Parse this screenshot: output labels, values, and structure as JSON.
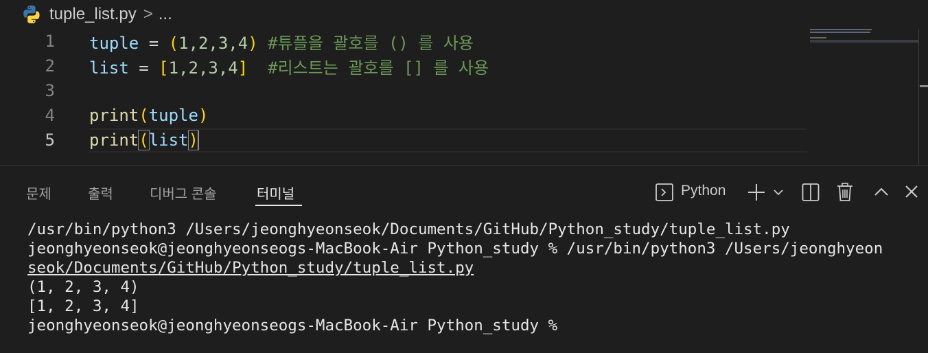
{
  "breadcrumb": {
    "file": "tuple_list.py",
    "separator": ">",
    "more": "..."
  },
  "editor": {
    "active_line": 5,
    "lines": [
      {
        "number": "1"
      },
      {
        "number": "2"
      },
      {
        "number": "3"
      },
      {
        "number": "4"
      },
      {
        "number": "5"
      }
    ],
    "tokens": {
      "l1_var": "tuple",
      "l1_eq": " = ",
      "l1_open": "(",
      "l1_nums": "1,2,3,4",
      "l1_close": ")",
      "l1_comment": " #튜플을 괄호를 () 를 사용",
      "l2_var": "list",
      "l2_eq": " = ",
      "l2_open": "[",
      "l2_nums": "1,2,3,4",
      "l2_close": "]",
      "l2_comment": "  #리스트는 괄호를 [] 를 사용",
      "l4_fn": "print",
      "l4_open": "(",
      "l4_arg": "tuple",
      "l4_close": ")",
      "l5_fn": "print",
      "l5_open": "(",
      "l5_arg": "list",
      "l5_close": ")"
    }
  },
  "panel": {
    "tabs": [
      {
        "label": "문제",
        "active": false
      },
      {
        "label": "출력",
        "active": false
      },
      {
        "label": "디버그 콘솔",
        "active": false
      },
      {
        "label": "터미널",
        "active": true
      }
    ],
    "terminal_name": "Python",
    "icons": [
      "terminal-icon",
      "add-icon",
      "chevron-down-icon",
      "split-icon",
      "trash-icon",
      "chevron-up-icon",
      "close-icon"
    ]
  },
  "terminal": {
    "lines": [
      "/usr/bin/python3 /Users/jeonghyeonseok/Documents/GitHub/Python_study/tuple_list.py",
      "jeonghyeonseok@jeonghyeonseogs-MacBook-Air Python_study % /usr/bin/python3 /Users/jeonghyeon",
      "seok/Documents/GitHub/Python_study/tuple_list.py",
      "(1, 2, 3, 4)",
      "[1, 2, 3, 4]",
      "jeonghyeonseok@jeonghyeonseogs-MacBook-Air Python_study % "
    ]
  },
  "colors": {
    "background": "#1e1e1e",
    "variable": "#9cdcfe",
    "function": "#dcdcaa",
    "number": "#b5cea8",
    "bracket": "#ffd700",
    "comment": "#6a9955",
    "python_blue": "#3776ab",
    "python_yellow": "#ffd43b"
  }
}
